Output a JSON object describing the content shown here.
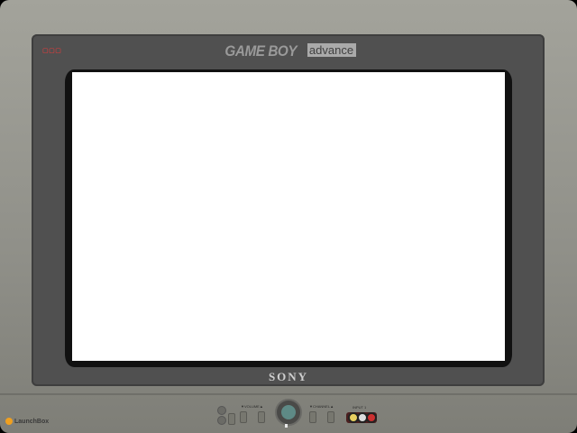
{
  "brand": {
    "gameboy": "GAME BOY",
    "advance": "advance"
  },
  "tv": {
    "manufacturer": "SONY",
    "volume_label": "▼VOLUME▲",
    "channel_label": "▼CHANNEL▲",
    "input_label": "INPUT 1"
  },
  "footer": {
    "launchbox": "LaunchBox"
  },
  "colors": {
    "screen": "#ffffff",
    "bezel": "#505050",
    "case": "#a3a39b"
  }
}
